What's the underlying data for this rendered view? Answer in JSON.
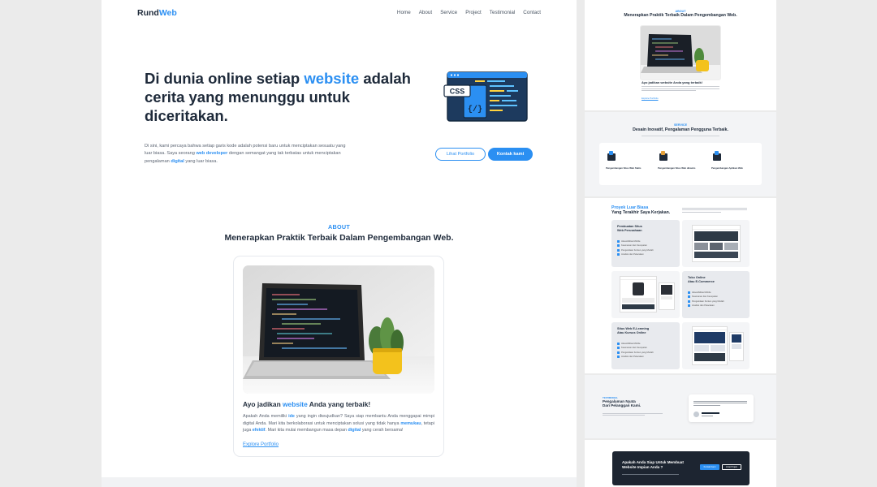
{
  "brand": {
    "name_part1": "Rund",
    "name_part2": "Web"
  },
  "nav": [
    "Home",
    "About",
    "Service",
    "Project",
    "Testimonial",
    "Contact"
  ],
  "hero": {
    "title_pre": "Di dunia online setiap ",
    "title_accent": "website",
    "title_post": " adalah cerita yang menunggu untuk diceritakan.",
    "desc_1": "Di sini, kami percaya bahwa setiap garis kode adalah potensi baru untuk menciptakan sesuatu yang luar biasa. Saya seorang ",
    "desc_accent1": "web developer",
    "desc_2": " dengan semangat yang tak terbatas untuk menciptakan pengalaman ",
    "desc_accent2": "digital",
    "desc_3": " yang luar biasa.",
    "btn_portfolio": "Lihat Portfolio",
    "btn_contact": "Kontak kami",
    "illus_label": "CSS",
    "illus_code": "{/}"
  },
  "about": {
    "label": "ABOUT",
    "title": "Menerapkan Praktik Terbaik Dalam Pengembangan Web.",
    "card_title_pre": "Ayo jadikan ",
    "card_title_accent": "website",
    "card_title_post": " Anda yang terbaik!",
    "desc_1": "Apakah Anda memiliki ",
    "desc_accent1": "ide",
    "desc_2": " yang ingin diwujudkan? Saya siap membantu Anda menggapai mimpi digital Anda. Mari kita berkolaborasi untuk menciptakan solusi yang tidak hanya ",
    "desc_accent2": "memukau",
    "desc_3": ", tetapi juga ",
    "desc_accent3": "efektif",
    "desc_4": ". Mari kita mulai membangun masa depan ",
    "desc_accent4": "digital",
    "desc_5": " yang cerah bersama!",
    "link": "Explore Portfolio"
  },
  "preview": {
    "about_label": "ABOUT",
    "about_title": "Menerapkan Praktik Terbaik Dalam Pengembangan Web.",
    "about_card_title": "Ayo jadikan website Anda yang terbaik!",
    "about_link": "Explore Portfolio",
    "service_label": "SERVICE",
    "service_title": "Desain Inovatif, Pengalaman Pengguna Terbaik.",
    "services": [
      "Pengembangan Situs Web Statis",
      "Pengembangan Situs Web dinamis",
      "Pengembangan Aplikasi Web"
    ],
    "project_title_1": "Proyek Luar Biasa",
    "project_title_2": "Yang Terakhir Saya Kerjakan.",
    "projects": [
      {
        "title_1": "Pembuatan Situs",
        "title_2": "Web Perusahaan"
      },
      {
        "title_1": "Toko Online",
        "title_2": "Atau E-Commerce"
      },
      {
        "title_1": "Situs Web E-Learning",
        "title_2": "Atau Kursus Online"
      }
    ],
    "checks": [
      "Aksesibilitas Mobile",
      "Keamanan dan Kecepatan",
      "Pengelolaan Konten yang Mudah",
      "Analisis dan Pelacakan"
    ],
    "testimonial_label": "TESTIMONIAL",
    "testimonial_title_1": "Pengalaman Nyata",
    "testimonial_title_2": "Dari Pelanggan Kami.",
    "cta_title_1": "Apakah Anda Siap Untuk Membuat",
    "cta_title_2": "Website Impian Anda ?",
    "cta_btn_1": "Kontak Kami",
    "cta_btn_2": "Lihat Projek"
  },
  "colors": {
    "accent": "#2b8ff2",
    "dark": "#1e2a3a",
    "cta_bg": "#1d2531"
  }
}
